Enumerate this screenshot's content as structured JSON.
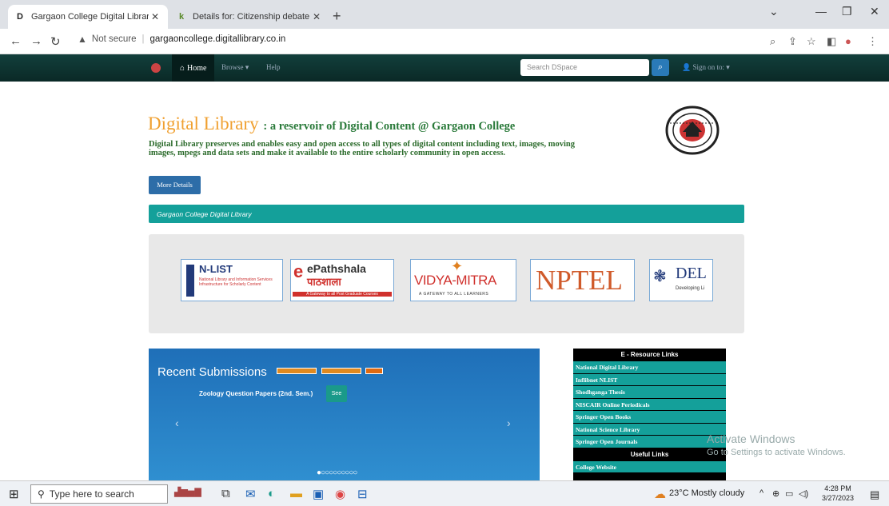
{
  "browser": {
    "tabs": [
      {
        "title": "Gargaon College Digital Library:",
        "favicon": "D",
        "active": true
      },
      {
        "title": "Details for: Citizenship debate o",
        "favicon": "k",
        "active": false
      }
    ],
    "address": {
      "security": "Not secure",
      "url": "gargaoncollege.digitallibrary.co.in"
    }
  },
  "site": {
    "nav": {
      "home": "Home",
      "browse": "Browse ▾",
      "help": "Help",
      "search_placeholder": "Search DSpace",
      "signin": "Sign on to: ▾"
    },
    "hero": {
      "title": "Digital Library",
      "subtitle": ": a reservoir of Digital Content @ Gargaon College",
      "description": "Digital Library preserves and enables easy and open access to all types of digital content including text, images, moving images, mpegs and data sets and make it available to the entire scholarly community in open access.",
      "more_button": "More Details"
    },
    "banner": "Gargaon College Digital Library",
    "logos": [
      {
        "name": "N-LIST",
        "caption": "National Library and Information Services Infrastructure for Scholarly Content"
      },
      {
        "name": "ePathshala",
        "hindi": "पाठशाला",
        "caption": "A Gateway to all Post Graduate Courses"
      },
      {
        "name": "VIDYA-MITRA",
        "caption": "A GATEWAY TO ALL LEARNERS"
      },
      {
        "name": "NPTEL",
        "caption": ""
      },
      {
        "name": "DEL",
        "caption": "Developing Li"
      }
    ],
    "recent": {
      "title": "Recent Submissions",
      "item": "Zoology Question Papers (2nd. Sem.)",
      "see": "See",
      "prev": "‹",
      "next": "›",
      "dots": "●○○○○○○○○○"
    },
    "eresources": {
      "header": "E - Resource Links",
      "links": [
        "National Digital Library",
        "Inflibnet NLIST",
        "Shodhganga Thesis",
        "NISCAIR Online Periodicals",
        "Springer Open Books",
        "National Science Library",
        "Springer Open Journals"
      ],
      "useful_header": "Useful Links",
      "useful_links": [
        "College Website"
      ]
    }
  },
  "watermark": {
    "line1": "Activate Windows",
    "line2": "Go to Settings to activate Windows."
  },
  "taskbar": {
    "search": "Type here to search",
    "weather": "23°C Mostly cloudy",
    "time": "4:28 PM",
    "date": "3/27/2023"
  }
}
